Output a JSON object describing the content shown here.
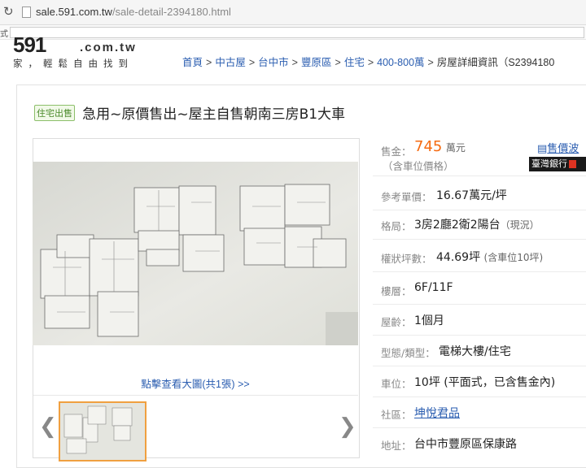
{
  "browser": {
    "url_domain": "sale.591.com.tw",
    "url_path": "/sale-detail-2394180.html",
    "bookmark_label": "式"
  },
  "logo": {
    "big": "591",
    "domain": ".com.tw",
    "slogan": "家，輕鬆自由找到"
  },
  "breadcrumb": {
    "items": [
      "首頁",
      "中古屋",
      "台中市",
      "豐原區",
      "住宅",
      "400-800萬"
    ],
    "current": "房屋詳細資訊（S2394180",
    "separator": ">"
  },
  "listing": {
    "tag": "住宅出售",
    "title": "急用~原價售出~屋主自售朝南三房B1大車"
  },
  "gallery": {
    "zoom_link": "點擊查看大圖(共1張) >>",
    "prev_arrow": "❮",
    "next_arrow": "❯"
  },
  "details": {
    "price_label": "售金：",
    "price_value": "745",
    "price_unit": "萬元",
    "price_note": "（含車位價格）",
    "unit_price_label": "參考單價：",
    "unit_price_value": "16.67萬元/坪",
    "layout_label": "格局：",
    "layout_value": "3房2廳2衛2陽台",
    "layout_note": "（現況）",
    "area_label": "權狀坪數：",
    "area_value": "44.69坪",
    "area_note": "(含車位10坪)",
    "floor_label": "樓層：",
    "floor_value": "6F/11F",
    "age_label": "屋齡：",
    "age_value": "1個月",
    "type_label": "型態/類型：",
    "type_value": "電梯大樓/住宅",
    "parking_label": "車位：",
    "parking_value": "10坪 (平面式，已含售金內)",
    "community_label": "社區：",
    "community_value": "坤悅君品",
    "address_label": "地址：",
    "address_value": "台中市豐原區保康路"
  },
  "side": {
    "sale_link": "售價波",
    "bank_label": "臺灣銀行"
  }
}
